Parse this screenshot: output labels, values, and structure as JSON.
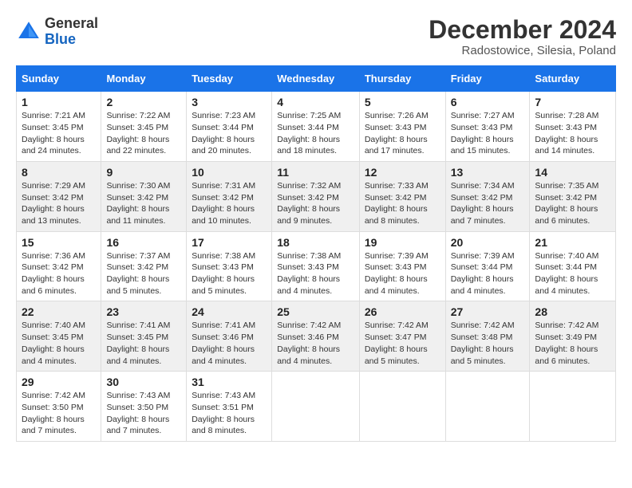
{
  "header": {
    "logo_general": "General",
    "logo_blue": "Blue",
    "month_year": "December 2024",
    "location": "Radostowice, Silesia, Poland"
  },
  "calendar": {
    "days_of_week": [
      "Sunday",
      "Monday",
      "Tuesday",
      "Wednesday",
      "Thursday",
      "Friday",
      "Saturday"
    ],
    "weeks": [
      [
        null,
        null,
        null,
        null,
        null,
        null,
        null
      ]
    ],
    "cells": {
      "w1": [
        {
          "day": "1",
          "sunrise": "Sunrise: 7:21 AM",
          "sunset": "Sunset: 3:45 PM",
          "daylight": "Daylight: 8 hours and 24 minutes."
        },
        {
          "day": "2",
          "sunrise": "Sunrise: 7:22 AM",
          "sunset": "Sunset: 3:45 PM",
          "daylight": "Daylight: 8 hours and 22 minutes."
        },
        {
          "day": "3",
          "sunrise": "Sunrise: 7:23 AM",
          "sunset": "Sunset: 3:44 PM",
          "daylight": "Daylight: 8 hours and 20 minutes."
        },
        {
          "day": "4",
          "sunrise": "Sunrise: 7:25 AM",
          "sunset": "Sunset: 3:44 PM",
          "daylight": "Daylight: 8 hours and 18 minutes."
        },
        {
          "day": "5",
          "sunrise": "Sunrise: 7:26 AM",
          "sunset": "Sunset: 3:43 PM",
          "daylight": "Daylight: 8 hours and 17 minutes."
        },
        {
          "day": "6",
          "sunrise": "Sunrise: 7:27 AM",
          "sunset": "Sunset: 3:43 PM",
          "daylight": "Daylight: 8 hours and 15 minutes."
        },
        {
          "day": "7",
          "sunrise": "Sunrise: 7:28 AM",
          "sunset": "Sunset: 3:43 PM",
          "daylight": "Daylight: 8 hours and 14 minutes."
        }
      ],
      "w2": [
        {
          "day": "8",
          "sunrise": "Sunrise: 7:29 AM",
          "sunset": "Sunset: 3:42 PM",
          "daylight": "Daylight: 8 hours and 13 minutes."
        },
        {
          "day": "9",
          "sunrise": "Sunrise: 7:30 AM",
          "sunset": "Sunset: 3:42 PM",
          "daylight": "Daylight: 8 hours and 11 minutes."
        },
        {
          "day": "10",
          "sunrise": "Sunrise: 7:31 AM",
          "sunset": "Sunset: 3:42 PM",
          "daylight": "Daylight: 8 hours and 10 minutes."
        },
        {
          "day": "11",
          "sunrise": "Sunrise: 7:32 AM",
          "sunset": "Sunset: 3:42 PM",
          "daylight": "Daylight: 8 hours and 9 minutes."
        },
        {
          "day": "12",
          "sunrise": "Sunrise: 7:33 AM",
          "sunset": "Sunset: 3:42 PM",
          "daylight": "Daylight: 8 hours and 8 minutes."
        },
        {
          "day": "13",
          "sunrise": "Sunrise: 7:34 AM",
          "sunset": "Sunset: 3:42 PM",
          "daylight": "Daylight: 8 hours and 7 minutes."
        },
        {
          "day": "14",
          "sunrise": "Sunrise: 7:35 AM",
          "sunset": "Sunset: 3:42 PM",
          "daylight": "Daylight: 8 hours and 6 minutes."
        }
      ],
      "w3": [
        {
          "day": "15",
          "sunrise": "Sunrise: 7:36 AM",
          "sunset": "Sunset: 3:42 PM",
          "daylight": "Daylight: 8 hours and 6 minutes."
        },
        {
          "day": "16",
          "sunrise": "Sunrise: 7:37 AM",
          "sunset": "Sunset: 3:42 PM",
          "daylight": "Daylight: 8 hours and 5 minutes."
        },
        {
          "day": "17",
          "sunrise": "Sunrise: 7:38 AM",
          "sunset": "Sunset: 3:43 PM",
          "daylight": "Daylight: 8 hours and 5 minutes."
        },
        {
          "day": "18",
          "sunrise": "Sunrise: 7:38 AM",
          "sunset": "Sunset: 3:43 PM",
          "daylight": "Daylight: 8 hours and 4 minutes."
        },
        {
          "day": "19",
          "sunrise": "Sunrise: 7:39 AM",
          "sunset": "Sunset: 3:43 PM",
          "daylight": "Daylight: 8 hours and 4 minutes."
        },
        {
          "day": "20",
          "sunrise": "Sunrise: 7:39 AM",
          "sunset": "Sunset: 3:44 PM",
          "daylight": "Daylight: 8 hours and 4 minutes."
        },
        {
          "day": "21",
          "sunrise": "Sunrise: 7:40 AM",
          "sunset": "Sunset: 3:44 PM",
          "daylight": "Daylight: 8 hours and 4 minutes."
        }
      ],
      "w4": [
        {
          "day": "22",
          "sunrise": "Sunrise: 7:40 AM",
          "sunset": "Sunset: 3:45 PM",
          "daylight": "Daylight: 8 hours and 4 minutes."
        },
        {
          "day": "23",
          "sunrise": "Sunrise: 7:41 AM",
          "sunset": "Sunset: 3:45 PM",
          "daylight": "Daylight: 8 hours and 4 minutes."
        },
        {
          "day": "24",
          "sunrise": "Sunrise: 7:41 AM",
          "sunset": "Sunset: 3:46 PM",
          "daylight": "Daylight: 8 hours and 4 minutes."
        },
        {
          "day": "25",
          "sunrise": "Sunrise: 7:42 AM",
          "sunset": "Sunset: 3:46 PM",
          "daylight": "Daylight: 8 hours and 4 minutes."
        },
        {
          "day": "26",
          "sunrise": "Sunrise: 7:42 AM",
          "sunset": "Sunset: 3:47 PM",
          "daylight": "Daylight: 8 hours and 5 minutes."
        },
        {
          "day": "27",
          "sunrise": "Sunrise: 7:42 AM",
          "sunset": "Sunset: 3:48 PM",
          "daylight": "Daylight: 8 hours and 5 minutes."
        },
        {
          "day": "28",
          "sunrise": "Sunrise: 7:42 AM",
          "sunset": "Sunset: 3:49 PM",
          "daylight": "Daylight: 8 hours and 6 minutes."
        }
      ],
      "w5": [
        {
          "day": "29",
          "sunrise": "Sunrise: 7:42 AM",
          "sunset": "Sunset: 3:50 PM",
          "daylight": "Daylight: 8 hours and 7 minutes."
        },
        {
          "day": "30",
          "sunrise": "Sunrise: 7:43 AM",
          "sunset": "Sunset: 3:50 PM",
          "daylight": "Daylight: 8 hours and 7 minutes."
        },
        {
          "day": "31",
          "sunrise": "Sunrise: 7:43 AM",
          "sunset": "Sunset: 3:51 PM",
          "daylight": "Daylight: 8 hours and 8 minutes."
        },
        null,
        null,
        null,
        null
      ]
    }
  }
}
